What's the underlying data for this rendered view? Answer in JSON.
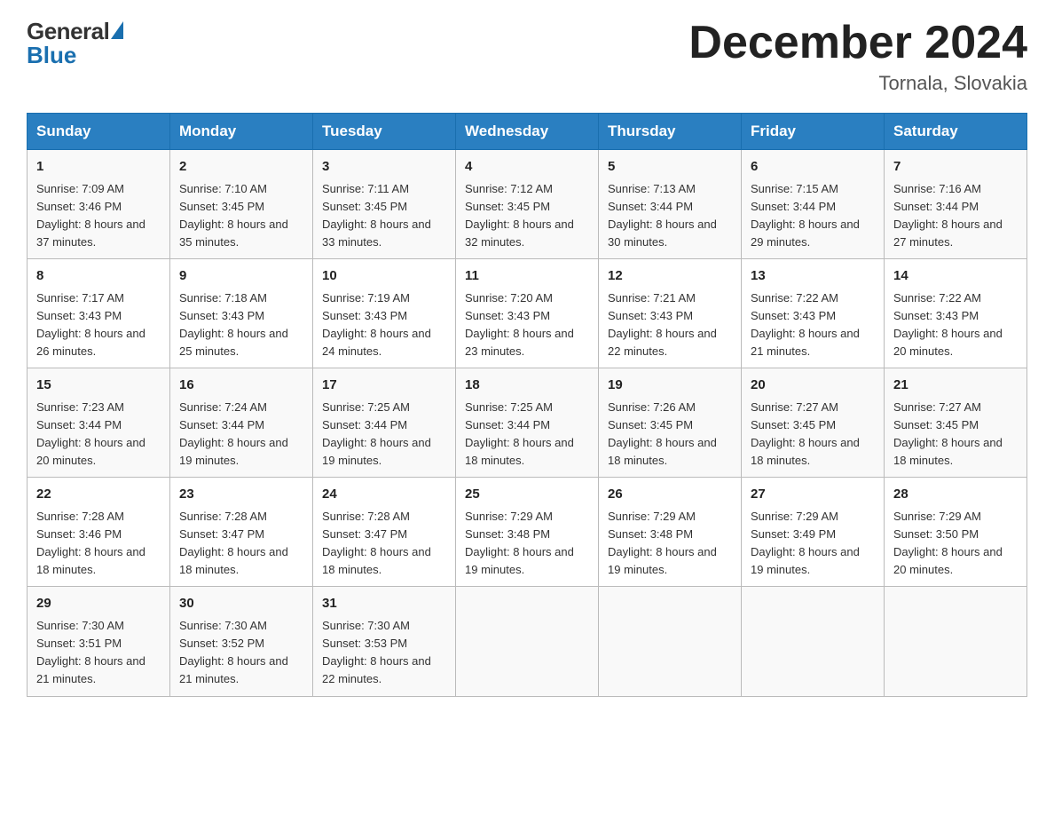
{
  "header": {
    "logo_general": "General",
    "logo_blue": "Blue",
    "month_title": "December 2024",
    "location": "Tornala, Slovakia"
  },
  "days_of_week": [
    "Sunday",
    "Monday",
    "Tuesday",
    "Wednesday",
    "Thursday",
    "Friday",
    "Saturday"
  ],
  "weeks": [
    [
      {
        "day": "1",
        "sunrise": "Sunrise: 7:09 AM",
        "sunset": "Sunset: 3:46 PM",
        "daylight": "Daylight: 8 hours and 37 minutes."
      },
      {
        "day": "2",
        "sunrise": "Sunrise: 7:10 AM",
        "sunset": "Sunset: 3:45 PM",
        "daylight": "Daylight: 8 hours and 35 minutes."
      },
      {
        "day": "3",
        "sunrise": "Sunrise: 7:11 AM",
        "sunset": "Sunset: 3:45 PM",
        "daylight": "Daylight: 8 hours and 33 minutes."
      },
      {
        "day": "4",
        "sunrise": "Sunrise: 7:12 AM",
        "sunset": "Sunset: 3:45 PM",
        "daylight": "Daylight: 8 hours and 32 minutes."
      },
      {
        "day": "5",
        "sunrise": "Sunrise: 7:13 AM",
        "sunset": "Sunset: 3:44 PM",
        "daylight": "Daylight: 8 hours and 30 minutes."
      },
      {
        "day": "6",
        "sunrise": "Sunrise: 7:15 AM",
        "sunset": "Sunset: 3:44 PM",
        "daylight": "Daylight: 8 hours and 29 minutes."
      },
      {
        "day": "7",
        "sunrise": "Sunrise: 7:16 AM",
        "sunset": "Sunset: 3:44 PM",
        "daylight": "Daylight: 8 hours and 27 minutes."
      }
    ],
    [
      {
        "day": "8",
        "sunrise": "Sunrise: 7:17 AM",
        "sunset": "Sunset: 3:43 PM",
        "daylight": "Daylight: 8 hours and 26 minutes."
      },
      {
        "day": "9",
        "sunrise": "Sunrise: 7:18 AM",
        "sunset": "Sunset: 3:43 PM",
        "daylight": "Daylight: 8 hours and 25 minutes."
      },
      {
        "day": "10",
        "sunrise": "Sunrise: 7:19 AM",
        "sunset": "Sunset: 3:43 PM",
        "daylight": "Daylight: 8 hours and 24 minutes."
      },
      {
        "day": "11",
        "sunrise": "Sunrise: 7:20 AM",
        "sunset": "Sunset: 3:43 PM",
        "daylight": "Daylight: 8 hours and 23 minutes."
      },
      {
        "day": "12",
        "sunrise": "Sunrise: 7:21 AM",
        "sunset": "Sunset: 3:43 PM",
        "daylight": "Daylight: 8 hours and 22 minutes."
      },
      {
        "day": "13",
        "sunrise": "Sunrise: 7:22 AM",
        "sunset": "Sunset: 3:43 PM",
        "daylight": "Daylight: 8 hours and 21 minutes."
      },
      {
        "day": "14",
        "sunrise": "Sunrise: 7:22 AM",
        "sunset": "Sunset: 3:43 PM",
        "daylight": "Daylight: 8 hours and 20 minutes."
      }
    ],
    [
      {
        "day": "15",
        "sunrise": "Sunrise: 7:23 AM",
        "sunset": "Sunset: 3:44 PM",
        "daylight": "Daylight: 8 hours and 20 minutes."
      },
      {
        "day": "16",
        "sunrise": "Sunrise: 7:24 AM",
        "sunset": "Sunset: 3:44 PM",
        "daylight": "Daylight: 8 hours and 19 minutes."
      },
      {
        "day": "17",
        "sunrise": "Sunrise: 7:25 AM",
        "sunset": "Sunset: 3:44 PM",
        "daylight": "Daylight: 8 hours and 19 minutes."
      },
      {
        "day": "18",
        "sunrise": "Sunrise: 7:25 AM",
        "sunset": "Sunset: 3:44 PM",
        "daylight": "Daylight: 8 hours and 18 minutes."
      },
      {
        "day": "19",
        "sunrise": "Sunrise: 7:26 AM",
        "sunset": "Sunset: 3:45 PM",
        "daylight": "Daylight: 8 hours and 18 minutes."
      },
      {
        "day": "20",
        "sunrise": "Sunrise: 7:27 AM",
        "sunset": "Sunset: 3:45 PM",
        "daylight": "Daylight: 8 hours and 18 minutes."
      },
      {
        "day": "21",
        "sunrise": "Sunrise: 7:27 AM",
        "sunset": "Sunset: 3:45 PM",
        "daylight": "Daylight: 8 hours and 18 minutes."
      }
    ],
    [
      {
        "day": "22",
        "sunrise": "Sunrise: 7:28 AM",
        "sunset": "Sunset: 3:46 PM",
        "daylight": "Daylight: 8 hours and 18 minutes."
      },
      {
        "day": "23",
        "sunrise": "Sunrise: 7:28 AM",
        "sunset": "Sunset: 3:47 PM",
        "daylight": "Daylight: 8 hours and 18 minutes."
      },
      {
        "day": "24",
        "sunrise": "Sunrise: 7:28 AM",
        "sunset": "Sunset: 3:47 PM",
        "daylight": "Daylight: 8 hours and 18 minutes."
      },
      {
        "day": "25",
        "sunrise": "Sunrise: 7:29 AM",
        "sunset": "Sunset: 3:48 PM",
        "daylight": "Daylight: 8 hours and 19 minutes."
      },
      {
        "day": "26",
        "sunrise": "Sunrise: 7:29 AM",
        "sunset": "Sunset: 3:48 PM",
        "daylight": "Daylight: 8 hours and 19 minutes."
      },
      {
        "day": "27",
        "sunrise": "Sunrise: 7:29 AM",
        "sunset": "Sunset: 3:49 PM",
        "daylight": "Daylight: 8 hours and 19 minutes."
      },
      {
        "day": "28",
        "sunrise": "Sunrise: 7:29 AM",
        "sunset": "Sunset: 3:50 PM",
        "daylight": "Daylight: 8 hours and 20 minutes."
      }
    ],
    [
      {
        "day": "29",
        "sunrise": "Sunrise: 7:30 AM",
        "sunset": "Sunset: 3:51 PM",
        "daylight": "Daylight: 8 hours and 21 minutes."
      },
      {
        "day": "30",
        "sunrise": "Sunrise: 7:30 AM",
        "sunset": "Sunset: 3:52 PM",
        "daylight": "Daylight: 8 hours and 21 minutes."
      },
      {
        "day": "31",
        "sunrise": "Sunrise: 7:30 AM",
        "sunset": "Sunset: 3:53 PM",
        "daylight": "Daylight: 8 hours and 22 minutes."
      },
      null,
      null,
      null,
      null
    ]
  ]
}
